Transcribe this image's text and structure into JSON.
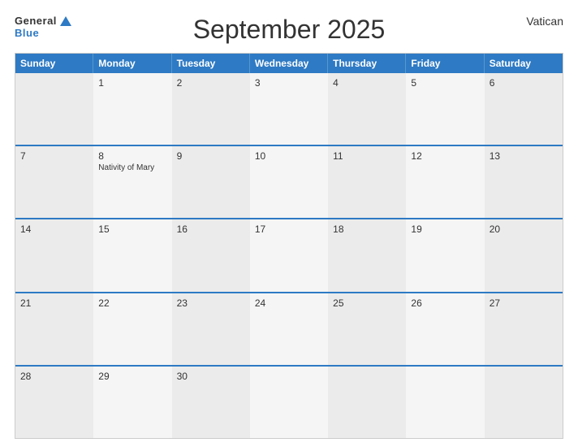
{
  "header": {
    "title": "September 2025",
    "country": "Vatican",
    "logo_general": "General",
    "logo_blue": "Blue"
  },
  "calendar": {
    "days_of_week": [
      "Sunday",
      "Monday",
      "Tuesday",
      "Wednesday",
      "Thursday",
      "Friday",
      "Saturday"
    ],
    "weeks": [
      [
        {
          "date": "",
          "event": ""
        },
        {
          "date": "1",
          "event": ""
        },
        {
          "date": "2",
          "event": ""
        },
        {
          "date": "3",
          "event": ""
        },
        {
          "date": "4",
          "event": ""
        },
        {
          "date": "5",
          "event": ""
        },
        {
          "date": "6",
          "event": ""
        }
      ],
      [
        {
          "date": "7",
          "event": ""
        },
        {
          "date": "8",
          "event": "Nativity of Mary"
        },
        {
          "date": "9",
          "event": ""
        },
        {
          "date": "10",
          "event": ""
        },
        {
          "date": "11",
          "event": ""
        },
        {
          "date": "12",
          "event": ""
        },
        {
          "date": "13",
          "event": ""
        }
      ],
      [
        {
          "date": "14",
          "event": ""
        },
        {
          "date": "15",
          "event": ""
        },
        {
          "date": "16",
          "event": ""
        },
        {
          "date": "17",
          "event": ""
        },
        {
          "date": "18",
          "event": ""
        },
        {
          "date": "19",
          "event": ""
        },
        {
          "date": "20",
          "event": ""
        }
      ],
      [
        {
          "date": "21",
          "event": ""
        },
        {
          "date": "22",
          "event": ""
        },
        {
          "date": "23",
          "event": ""
        },
        {
          "date": "24",
          "event": ""
        },
        {
          "date": "25",
          "event": ""
        },
        {
          "date": "26",
          "event": ""
        },
        {
          "date": "27",
          "event": ""
        }
      ],
      [
        {
          "date": "28",
          "event": ""
        },
        {
          "date": "29",
          "event": ""
        },
        {
          "date": "30",
          "event": ""
        },
        {
          "date": "",
          "event": ""
        },
        {
          "date": "",
          "event": ""
        },
        {
          "date": "",
          "event": ""
        },
        {
          "date": "",
          "event": ""
        }
      ]
    ]
  },
  "colors": {
    "header_bg": "#2e7ac4",
    "accent": "#2e7ac4",
    "cell_odd": "#ebebeb",
    "cell_even": "#f5f5f5"
  }
}
